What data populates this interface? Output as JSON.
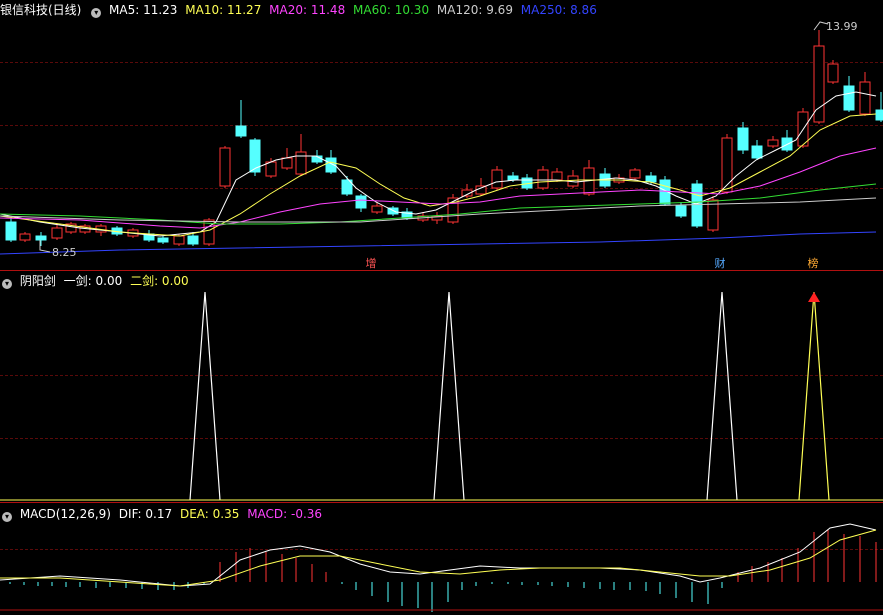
{
  "main_panel": {
    "title": "银信科技(日线)",
    "ma": [
      {
        "label": "MA5: 11.23",
        "color": "#ffffff"
      },
      {
        "label": "MA10: 11.27",
        "color": "#ffff55"
      },
      {
        "label": "MA20: 11.48",
        "color": "#ff44ff"
      },
      {
        "label": "MA60: 10.30",
        "color": "#33dd33"
      },
      {
        "label": "MA120: 9.69",
        "color": "#cccccc"
      },
      {
        "label": "MA250: 8.86",
        "color": "#3344ff"
      }
    ],
    "high_label": "13.99",
    "low_label": "8.25",
    "events": [
      {
        "text": "增",
        "color": "#ff5555"
      },
      {
        "text": "财",
        "color": "#55aaff"
      },
      {
        "text": "榜",
        "color": "#ffaa33"
      }
    ]
  },
  "indicator_panel": {
    "title": "阴阳剑",
    "line1": "一剑: 0.00",
    "line2": "二剑: 0.00",
    "line1_color": "#ffffff",
    "line2_color": "#ffff55"
  },
  "macd_panel": {
    "title": "MACD(12,26,9)",
    "dif": "DIF: 0.17",
    "dea": "DEA: 0.35",
    "macd": "MACD: -0.36",
    "dif_color": "#ffffff",
    "dea_color": "#ffff55",
    "macd_color": "#ff44ff"
  },
  "colors": {
    "up_candle": "#ff3333",
    "down_candle": "#55ffff",
    "grid": "#5a0a0a"
  }
}
